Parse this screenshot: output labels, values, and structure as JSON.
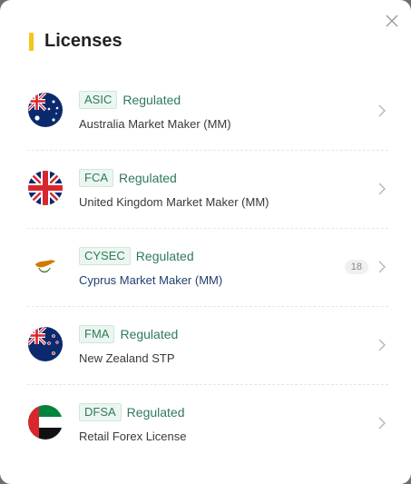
{
  "header": {
    "title": "Licenses"
  },
  "licenses": [
    {
      "code": "ASIC",
      "status": "Regulated",
      "detail": "Australia  Market Maker (MM)",
      "flag": "australia-flag-icon"
    },
    {
      "code": "FCA",
      "status": "Regulated",
      "detail": "United Kingdom  Market Maker (MM)",
      "flag": "uk-flag-icon"
    },
    {
      "code": "CYSEC",
      "status": "Regulated",
      "detail": "Cyprus  Market Maker (MM)",
      "flag": "cyprus-flag-icon",
      "count": "18"
    },
    {
      "code": "FMA",
      "status": "Regulated",
      "detail": "New Zealand  STP",
      "flag": "new-zealand-flag-icon"
    },
    {
      "code": "DFSA",
      "status": "Regulated",
      "detail": "Retail Forex License",
      "flag": "uae-flag-icon"
    }
  ],
  "colors": {
    "accent": "#f5c518",
    "regulated_green": "#2f7a5a",
    "link_blue": "#1f3f6e"
  }
}
